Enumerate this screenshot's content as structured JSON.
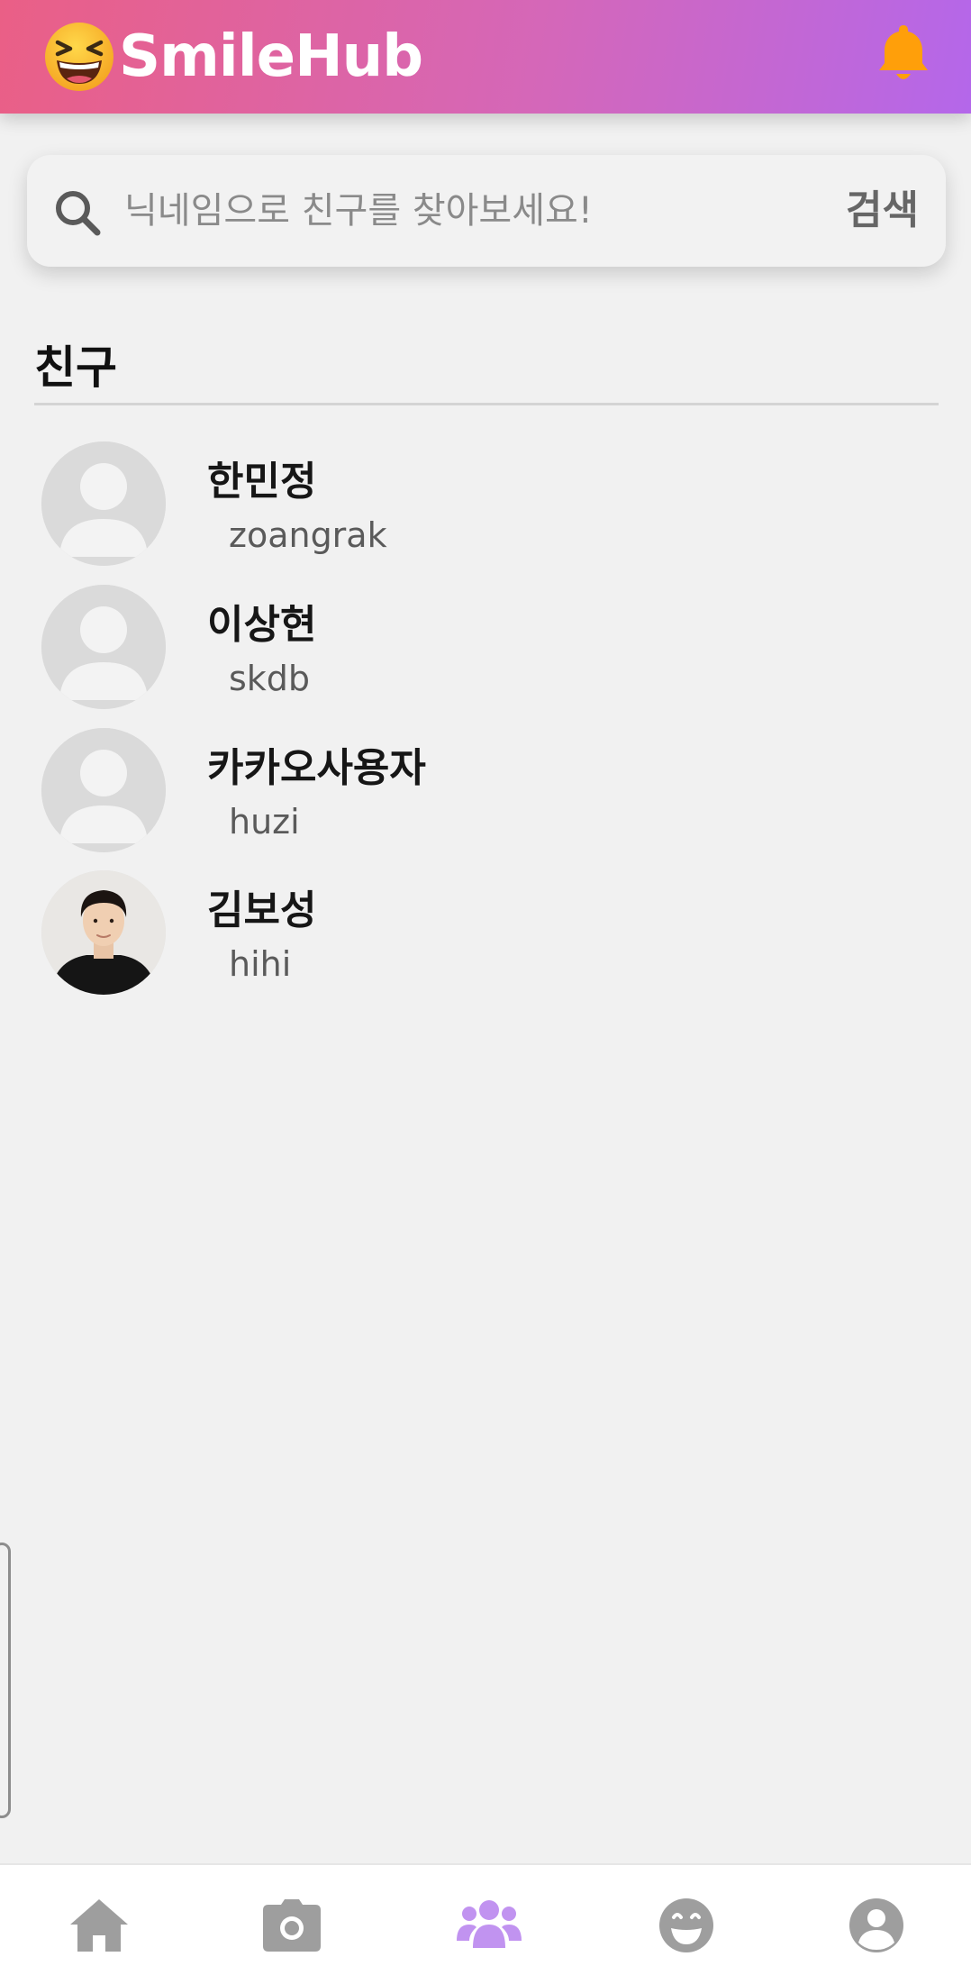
{
  "app": {
    "name": "SmileHub"
  },
  "colors": {
    "header_start": "#ea5f86",
    "header_end": "#b467ea",
    "bell": "#ff9f0a",
    "nav_active": "#c193f0",
    "nav_inactive": "#9e9e9e"
  },
  "search": {
    "placeholder": "닉네임으로 친구를 찾아보세요!",
    "value": "",
    "button_label": "검색"
  },
  "friends_section": {
    "title": "친구",
    "items": [
      {
        "name": "한민정",
        "id": "zoangrak",
        "avatar": "default-avatar"
      },
      {
        "name": "이상현",
        "id": "skdb",
        "avatar": "default-avatar"
      },
      {
        "name": "카카오사용자",
        "id": "huzi",
        "avatar": "default-avatar"
      },
      {
        "name": "김보성",
        "id": "hihi",
        "avatar": "profile-photo"
      }
    ]
  },
  "bottom_nav": {
    "items": [
      {
        "icon": "home-icon",
        "active": false
      },
      {
        "icon": "camera-icon",
        "active": false
      },
      {
        "icon": "friends-icon",
        "active": true
      },
      {
        "icon": "smile-icon",
        "active": false
      },
      {
        "icon": "profile-icon",
        "active": false
      }
    ]
  }
}
